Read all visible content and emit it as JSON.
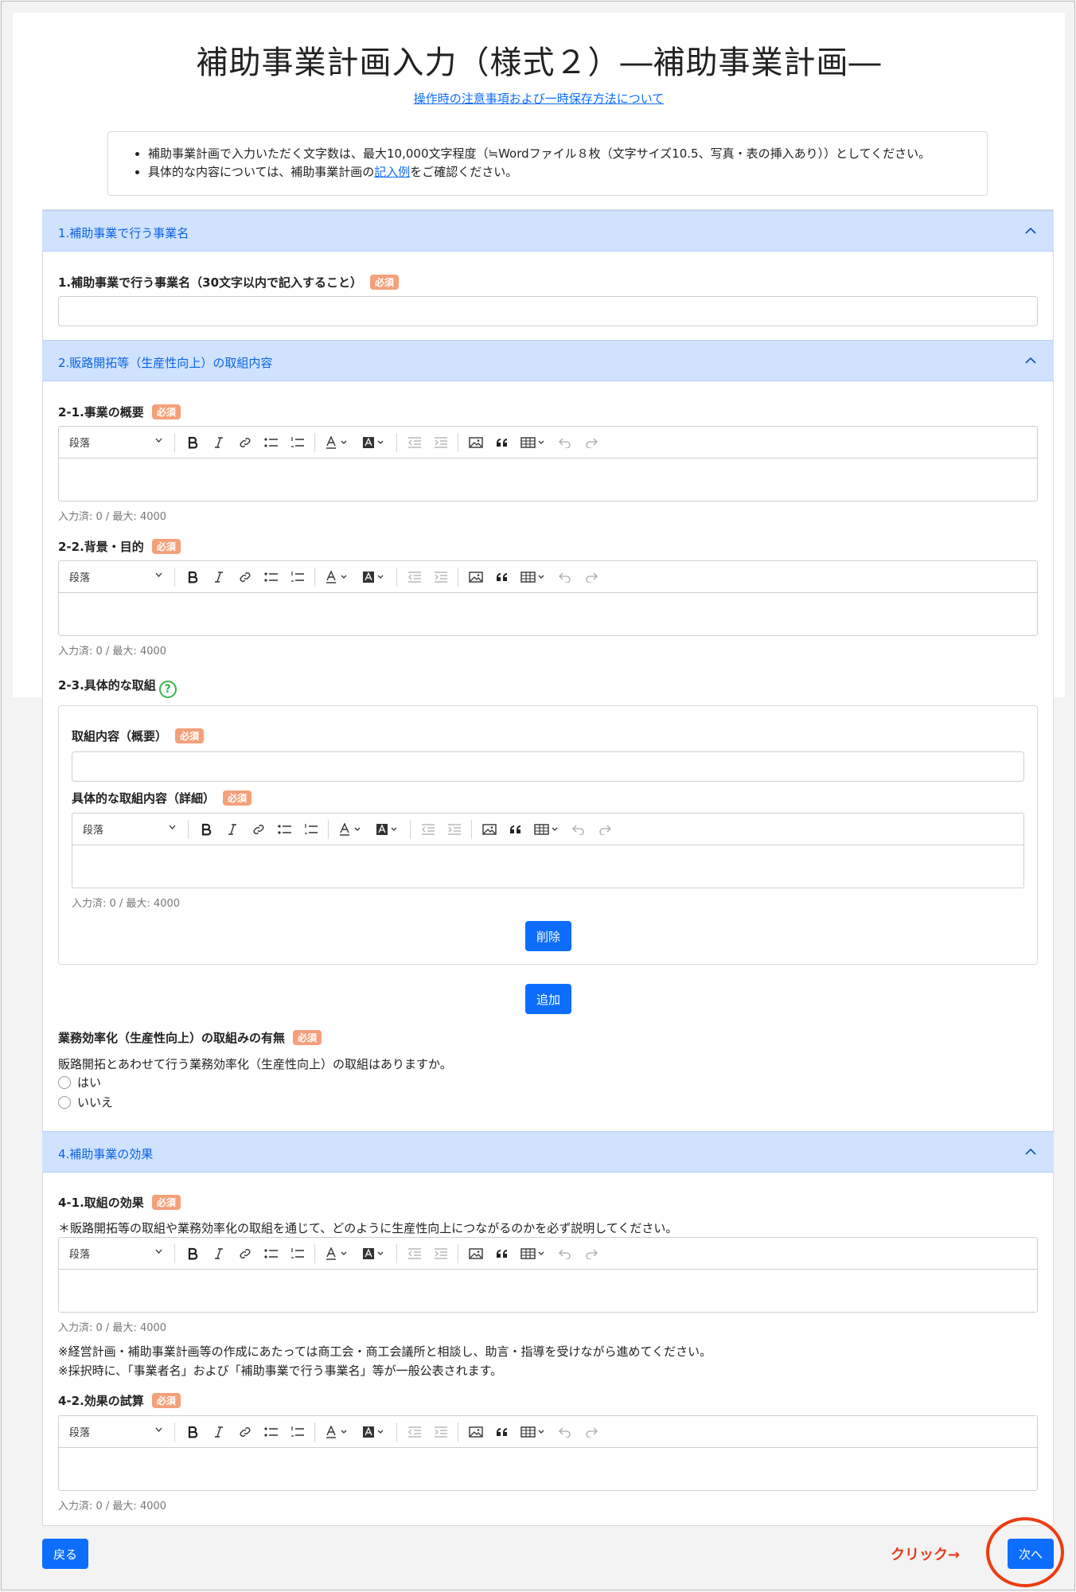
{
  "page": {
    "title": "補助事業計画入力（様式２）―補助事業計画―",
    "notice_link": "操作時の注意事項および一時保存方法について",
    "info": {
      "item1": "補助事業計画で入力いただく文字数は、最大10,000文字程度（≒Wordファイル８枚（文字サイズ10.5、写真・表の挿入あり））としてください。",
      "item2_prefix": "具体的な内容については、補助事業計画の",
      "item2_link": "記入例",
      "item2_suffix": "をご確認ください。"
    }
  },
  "required_badge": "必須",
  "toolbar": {
    "paragraph": "段落"
  },
  "counter_text": "入力済: 0 / 最大: 4000",
  "section1": {
    "header": "1.補助事業で行う事業名",
    "field_label": "1.補助事業で行う事業名（30文字以内で記入すること）"
  },
  "section2": {
    "header": "2.販路開拓等（生産性向上）の取組内容",
    "field_2_1": "2-1.事業の概要",
    "field_2_2": "2-2.背景・目的",
    "field_2_3": "2-3.具体的な取組",
    "help_icon": "?",
    "sub_summary": "取組内容（概要）",
    "sub_detail": "具体的な取組内容（詳細）",
    "delete_button": "削除",
    "add_button": "追加",
    "efficiency_label": "業務効率化（生産性向上）の取組みの有無",
    "efficiency_question": "販路開拓とあわせて行う業務効率化（生産性向上）の取組はありますか。",
    "option_yes": "はい",
    "option_no": "いいえ"
  },
  "section4": {
    "header": "4.補助事業の効果",
    "field_4_1": "4-1.取組の効果",
    "note_4_1": "＊販路開拓等の取組や業務効率化の取組を通じて、どのように生産性向上につながるのかを必ず説明してください。",
    "note_a": "※経営計画・補助事業計画等の作成にあたっては商工会・商工会議所と相談し、助言・指導を受けながら進めてください。",
    "note_b": "※採択時に、「事業者名」および「補助事業で行う事業名」等が一般公表されます。",
    "field_4_2": "4-2.効果の試算"
  },
  "footer": {
    "back_button": "戻る",
    "next_button": "次へ",
    "annotation": "クリック→"
  },
  "colors": {
    "accent": "#0d6efd",
    "section_header_bg": "#cfe2ff",
    "required_badge": "#f4a07a",
    "annotation": "#e8381a",
    "help_icon": "#35b64c"
  }
}
